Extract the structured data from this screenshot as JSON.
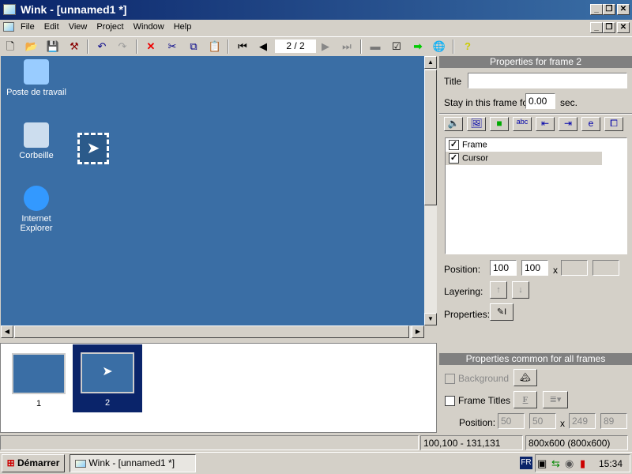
{
  "window": {
    "title": "Wink - [unnamed1 *]",
    "minimize": "_",
    "restore": "❐",
    "close": "✕"
  },
  "menu": [
    "File",
    "Edit",
    "View",
    "Project",
    "Window",
    "Help"
  ],
  "toolbar": {
    "frame_counter": "2 / 2"
  },
  "desktop": {
    "icons": [
      "Poste de travail",
      "Corbeille",
      "Internet Explorer"
    ]
  },
  "thumbnails": [
    {
      "label": "1",
      "selected": false
    },
    {
      "label": "2",
      "selected": true
    }
  ],
  "frame_props": {
    "header": "Properties for frame 2",
    "title_label": "Title",
    "title_value": "",
    "stay_label": "Stay in this frame for",
    "stay_value": "0.00",
    "stay_unit": "sec.",
    "items": [
      {
        "label": "Frame",
        "checked": true
      },
      {
        "label": "Cursor",
        "checked": true,
        "selected": true
      }
    ],
    "position_label": "Position:",
    "pos_x": "100",
    "pos_y": "100",
    "x_sep": "x",
    "layering_label": "Layering:",
    "properties_label": "Properties:"
  },
  "common_props": {
    "header": "Properties common for all frames",
    "background_label": "Background",
    "frame_titles_label": "Frame Titles",
    "font_button": "F",
    "position_label": "Position:",
    "pos_x": "50",
    "pos_y": "50",
    "x_sep": "x",
    "width": "249",
    "height": "89"
  },
  "status": {
    "coords": "100,100 - 131,131",
    "size": "800x600 (800x600)"
  },
  "taskbar": {
    "start": "Démarrer",
    "task": "Wink - [unnamed1 *]",
    "lang": "FR",
    "clock": "15:34"
  }
}
